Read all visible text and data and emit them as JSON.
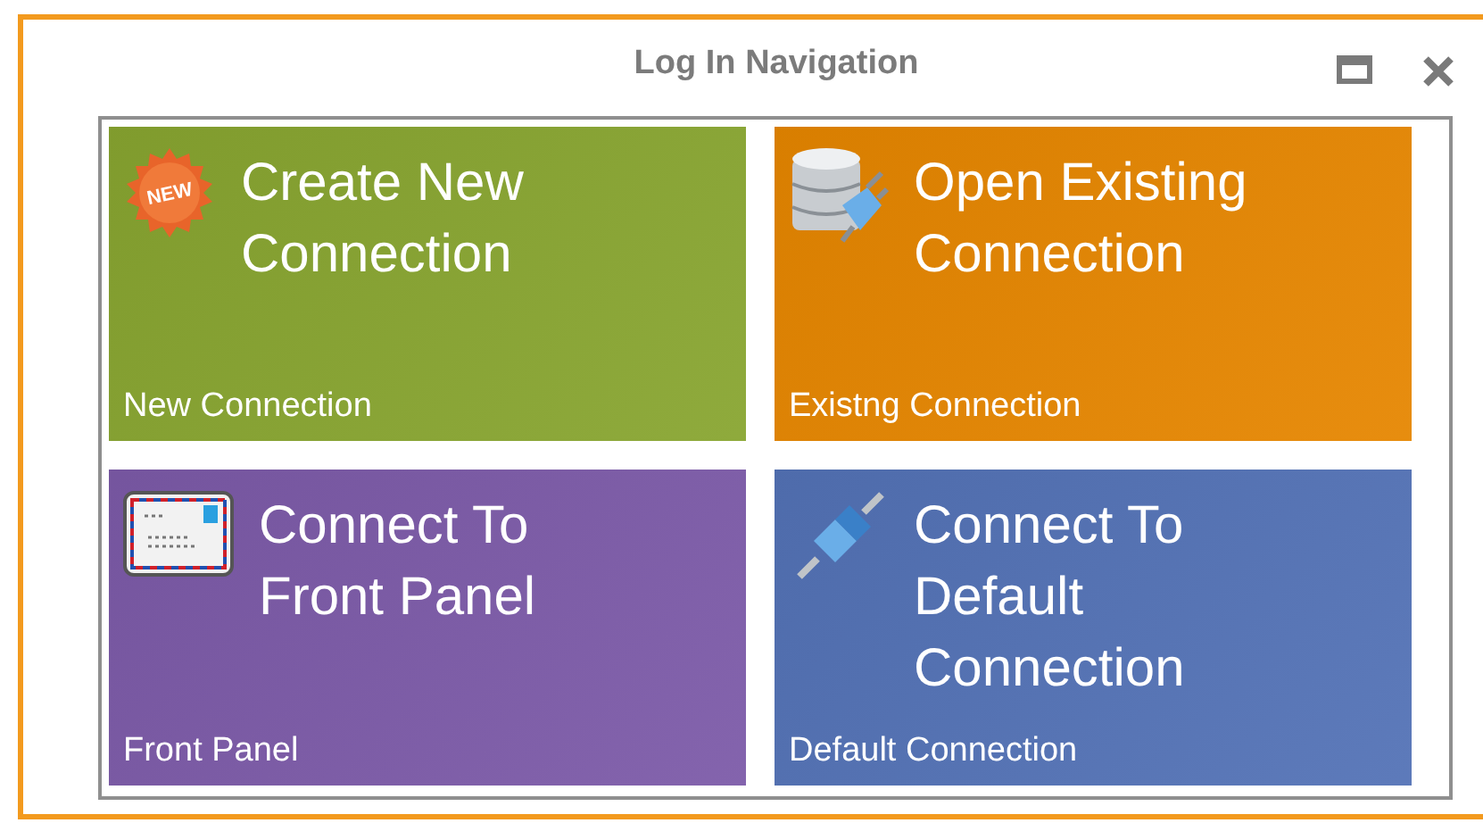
{
  "window": {
    "title": "Log In Navigation"
  },
  "tiles": [
    {
      "kind": "new",
      "badge": "NEW",
      "title": "Create New Connection",
      "subtitle": "New Connection",
      "color": "#88a530"
    },
    {
      "kind": "database",
      "title": "Open Existing Connection",
      "subtitle": "Existng Connection",
      "color": "#e68600"
    },
    {
      "kind": "envelope",
      "title": "Connect To Front Panel",
      "subtitle": "Front Panel",
      "color": "#7c5aa8"
    },
    {
      "kind": "plug",
      "title": "Connect To Default Connection",
      "subtitle": "Default Connection",
      "color": "#5372b6"
    }
  ]
}
